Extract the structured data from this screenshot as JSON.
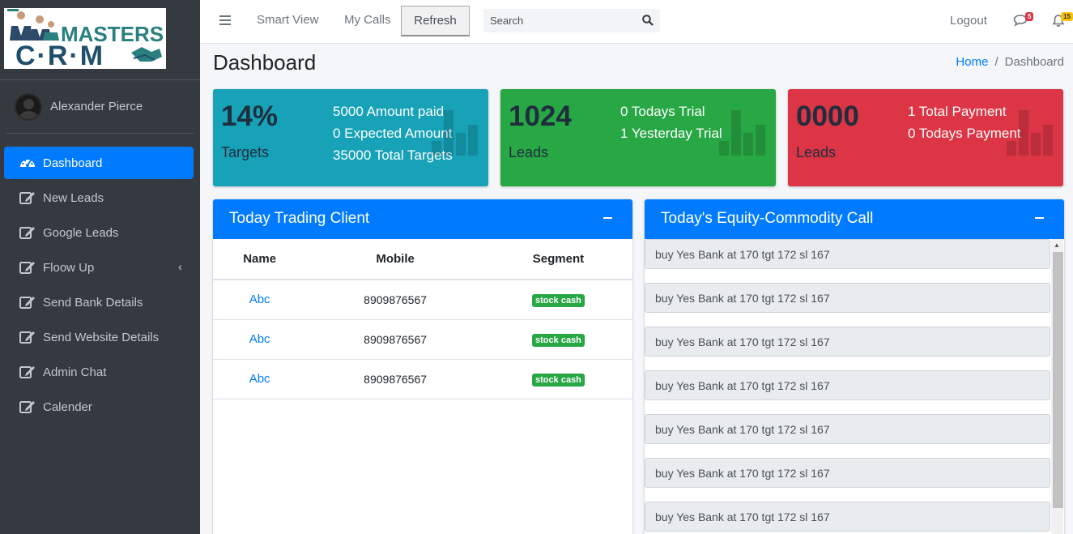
{
  "brand": {
    "word1": "MASTERS",
    "word2": "C·R·M"
  },
  "user": {
    "name": "Alexander Pierce"
  },
  "sidebar": {
    "items": [
      {
        "label": "Dashboard"
      },
      {
        "label": "New Leads"
      },
      {
        "label": "Google Leads"
      },
      {
        "label": "Floow Up"
      },
      {
        "label": "Send Bank Details"
      },
      {
        "label": "Send Website Details"
      },
      {
        "label": "Admin Chat"
      },
      {
        "label": "Calender"
      }
    ]
  },
  "topbar": {
    "smart_view": "Smart View",
    "my_calls": "My Calls",
    "refresh": "Refresh",
    "search_placeholder": "Search",
    "logout": "Logout",
    "messages_count": "5",
    "notifications_count": "15"
  },
  "header": {
    "title": "Dashboard",
    "breadcrumb_home": "Home",
    "breadcrumb_sep": "/",
    "breadcrumb_current": "Dashboard"
  },
  "stats": [
    {
      "value": "14%",
      "label": "Targets",
      "lines": [
        "5000 Amount paid",
        "0 Expected Amount",
        "35000 Total Targets"
      ],
      "color": "#17a2b8"
    },
    {
      "value": "1024",
      "label": "Leads",
      "lines": [
        "0 Todays Trial",
        "1 Yesterday Trial"
      ],
      "color": "#28a745"
    },
    {
      "value": "0000",
      "label": "Leads",
      "lines": [
        "1 Total Payment",
        "0 Todays Payment"
      ],
      "color": "#dc3545"
    }
  ],
  "trading": {
    "title": "Today Trading Client",
    "columns": [
      "Name",
      "Mobile",
      "Segment"
    ],
    "rows": [
      {
        "name": "Abc",
        "mobile": "8909876567",
        "segment": "stock cash"
      },
      {
        "name": "Abc",
        "mobile": "8909876567",
        "segment": "stock cash"
      },
      {
        "name": "Abc",
        "mobile": "8909876567",
        "segment": "stock cash"
      }
    ]
  },
  "calls": {
    "title": "Today's Equity-Commodity Call",
    "items": [
      "buy Yes Bank at 170 tgt 172 sl 167",
      "buy Yes Bank at 170 tgt 172 sl 167",
      "buy Yes Bank at 170 tgt 172 sl 167",
      "buy Yes Bank at 170 tgt 172 sl 167",
      "buy Yes Bank at 170 tgt 172 sl 167",
      "buy Yes Bank at 170 tgt 172 sl 167",
      "buy Yes Bank at 170 tgt 172 sl 167"
    ]
  },
  "colors": {
    "primary": "#007bff",
    "sidebar": "#343a40",
    "success": "#28a745",
    "danger": "#dc3545",
    "info": "#17a2b8"
  }
}
